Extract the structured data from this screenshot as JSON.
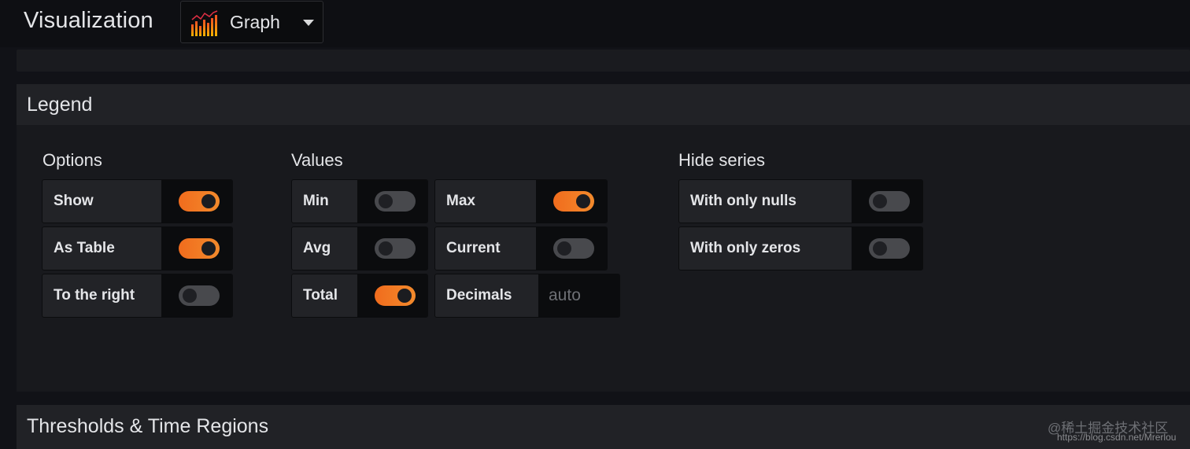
{
  "header": {
    "title": "Visualization",
    "picker_label": "Graph"
  },
  "legend": {
    "title": "Legend",
    "options": {
      "title": "Options",
      "items": [
        {
          "label": "Show",
          "on": true
        },
        {
          "label": "As Table",
          "on": true
        },
        {
          "label": "To the right",
          "on": false
        }
      ]
    },
    "values": {
      "title": "Values",
      "min": {
        "label": "Min",
        "on": false
      },
      "avg": {
        "label": "Avg",
        "on": false
      },
      "total": {
        "label": "Total",
        "on": true
      },
      "max": {
        "label": "Max",
        "on": true
      },
      "current": {
        "label": "Current",
        "on": false
      },
      "decimals": {
        "label": "Decimals",
        "placeholder": "auto"
      }
    },
    "hide_series": {
      "title": "Hide series",
      "items": [
        {
          "label": "With only nulls",
          "on": false
        },
        {
          "label": "With only zeros",
          "on": false
        }
      ]
    }
  },
  "thresholds": {
    "title": "Thresholds & Time Regions"
  },
  "watermark": {
    "line1": "@稀土掘金技术社区",
    "line2": "https://blog.csdn.net/Mrerlou"
  },
  "colors": {
    "accent": "#f16c1d",
    "toggle_off": "#48494d",
    "background": "#111217"
  }
}
